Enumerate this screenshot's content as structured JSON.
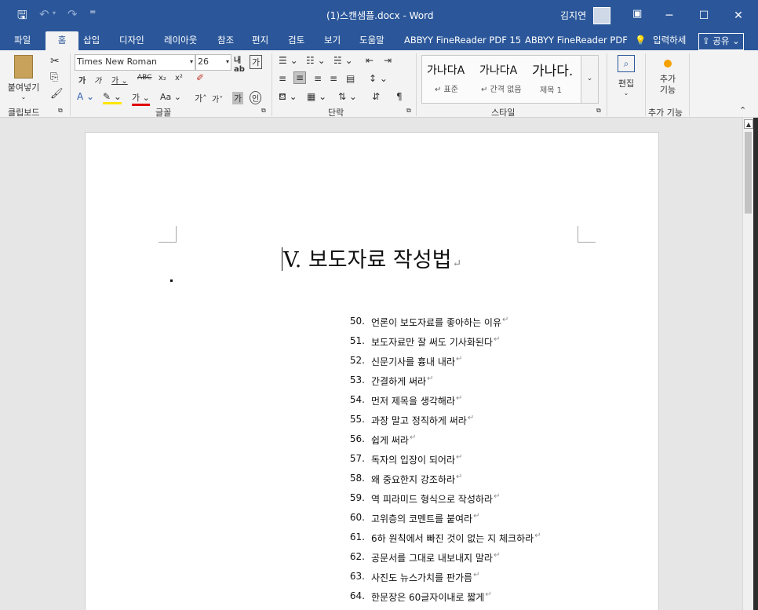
{
  "window": {
    "title": "(1)스캔샘플.docx - Word",
    "user": "김지연"
  },
  "menu": {
    "tabs": [
      "파일",
      "홈",
      "삽입",
      "디자인",
      "레이아웃",
      "참조",
      "편지",
      "검토",
      "보기",
      "도움말",
      "ABBYY FineReader PDF 15",
      "ABBYY FineReader PDF"
    ],
    "search": "입력하세",
    "share": "공유"
  },
  "ribbon": {
    "paste": "붙여넣기",
    "font_name": "Times New Roman",
    "font_size": "26",
    "style_samples": [
      "가나다A",
      "가나다A",
      "가나다."
    ],
    "style_names": [
      "↵ 표준",
      "↵ 간격 없음",
      "제목 1"
    ],
    "edit": "편집",
    "addins": "추가\n기능",
    "group_labels": [
      "클립보드",
      "글꼴",
      "단락",
      "스타일",
      "추가 기능"
    ]
  },
  "document": {
    "title": "V. 보도자료 작성법",
    "items": [
      {
        "num": "50.",
        "text": "언론이 보도자료를 좋아하는 이유"
      },
      {
        "num": "51.",
        "text": "보도자료만 잘 써도 기사화된다"
      },
      {
        "num": "52.",
        "text": "신문기사를 흉내 내라"
      },
      {
        "num": "53.",
        "text": "간결하게 써라"
      },
      {
        "num": "54.",
        "text": "먼저 제목을 생각해라"
      },
      {
        "num": "55.",
        "text": "과장 말고 정직하게 써라"
      },
      {
        "num": "56.",
        "text": "쉽게 써라"
      },
      {
        "num": "57.",
        "text": "독자의 입장이 되어라"
      },
      {
        "num": "58.",
        "text": "왜 중요한지 강조하라"
      },
      {
        "num": "59.",
        "text": "역 피라미드 형식으로 작성하라"
      },
      {
        "num": "60.",
        "text": "고위층의 코멘트를 붙여라"
      },
      {
        "num": "61.",
        "text": "6하 원칙에서 빠진 것이 없는 지 체크하라"
      },
      {
        "num": "62.",
        "text": "공문서를 그대로 내보내지 말라"
      },
      {
        "num": "63.",
        "text": "사진도 뉴스가치를 판가름"
      },
      {
        "num": "64.",
        "text": "한문장은 60글자이내로 짧게"
      }
    ]
  },
  "colors": {
    "accent": "#2b579a",
    "page": "#ffffff",
    "canvas": "#e6e6e6"
  }
}
